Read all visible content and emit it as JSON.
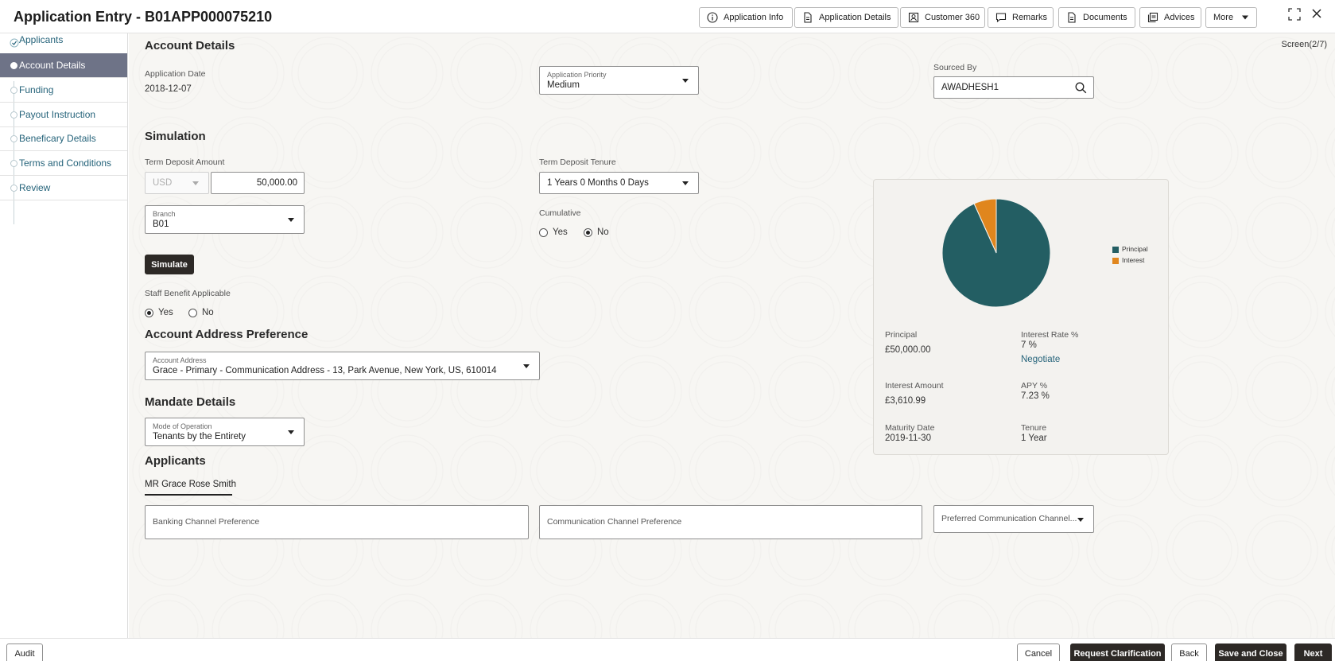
{
  "header": {
    "title": "Application Entry - B01APP000075210",
    "buttons": [
      {
        "label": "Application Info",
        "icon": "info-icon"
      },
      {
        "label": "Application Details",
        "icon": "document-icon"
      },
      {
        "label": "Customer 360",
        "icon": "person-card-icon"
      },
      {
        "label": "Remarks",
        "icon": "chat-icon"
      },
      {
        "label": "Documents",
        "icon": "document-icon"
      },
      {
        "label": "Advices",
        "icon": "stack-icon"
      },
      {
        "label": "More",
        "icon": "chevron-down-icon"
      }
    ]
  },
  "sidebar": {
    "steps": [
      {
        "label": "Applicants",
        "state": "done"
      },
      {
        "label": "Account Details",
        "state": "active"
      },
      {
        "label": "Funding",
        "state": "todo"
      },
      {
        "label": "Payout Instruction",
        "state": "todo"
      },
      {
        "label": "Beneficary Details",
        "state": "todo"
      },
      {
        "label": "Terms and Conditions",
        "state": "todo"
      },
      {
        "label": "Review",
        "state": "todo"
      }
    ]
  },
  "main": {
    "screen": "Screen(2/7)",
    "account_details": {
      "title": "Account Details",
      "application_date_label": "Application Date",
      "application_date": "2018-12-07",
      "priority_label": "Application Priority",
      "priority": "Medium",
      "sourced_by_label": "Sourced By",
      "sourced_by": "AWADHESH1"
    },
    "simulation": {
      "title": "Simulation",
      "amount_label": "Term Deposit Amount",
      "currency": "USD",
      "amount": "50,000.00",
      "tenure_label": "Term Deposit Tenure",
      "tenure": "1 Years 0 Months 0 Days",
      "branch_label": "Branch",
      "branch": "B01",
      "cumulative_label": "Cumulative",
      "cumulative_yes": "Yes",
      "cumulative_no": "No",
      "cumulative_selected": "No",
      "simulate_label": "Simulate",
      "staff_benefit_label": "Staff Benefit Applicable",
      "staff_yes": "Yes",
      "staff_no": "No",
      "staff_selected": "Yes"
    },
    "address": {
      "title": "Account Address Preference",
      "field_label": "Account Address",
      "value": "Grace - Primary - Communication Address - 13, Park Avenue, New York, US, 610014"
    },
    "mandate": {
      "title": "Mandate Details",
      "mode_label": "Mode of Operation",
      "mode": "Tenants by the Entirety"
    },
    "applicants": {
      "title": "Applicants",
      "tab": "MR Grace Rose Smith",
      "banking_placeholder": "Banking Channel Preference",
      "communication_placeholder": "Communication Channel Preference",
      "preferred_placeholder": "Preferred Communication Channel..."
    },
    "summary": {
      "principal_label": "Principal",
      "principal": "£50,000.00",
      "interest_rate_label": "Interest Rate %",
      "interest_rate": "7 %",
      "negotiate": "Negotiate",
      "interest_amount_label": "Interest Amount",
      "interest_amount": "£3,610.99",
      "apy_label": "APY %",
      "apy": "7.23 %",
      "maturity_label": "Maturity Date",
      "maturity": "2019-11-30",
      "tenure_label": "Tenure",
      "tenure": "1 Year"
    }
  },
  "chart_data": {
    "type": "pie",
    "labels": [
      "Principal",
      "Interest"
    ],
    "values": [
      50000,
      3610.99
    ],
    "colors": [
      "#235e63",
      "#e0861d"
    ],
    "legend": "right"
  },
  "footer": {
    "audit": "Audit",
    "cancel": "Cancel",
    "request_clarification": "Request Clarification",
    "back": "Back",
    "save_and_close": "Save and Close",
    "next": "Next"
  }
}
